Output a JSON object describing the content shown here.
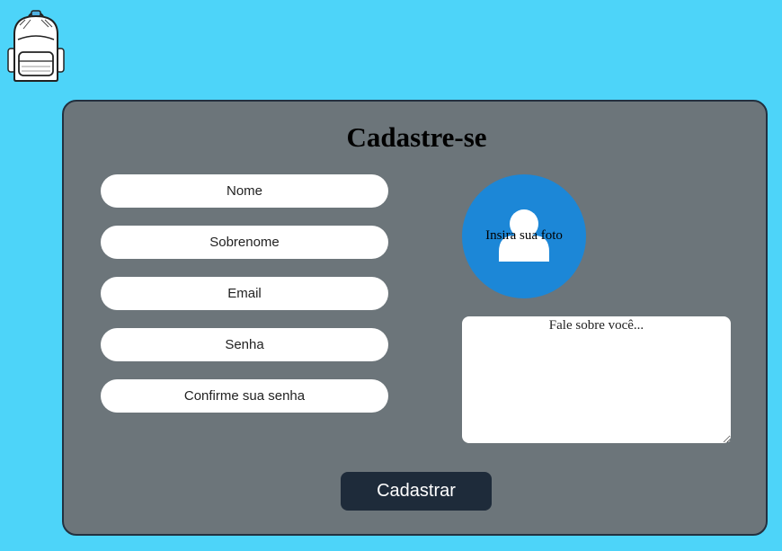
{
  "form": {
    "title": "Cadastre-se",
    "fields": {
      "nome": "Nome",
      "sobrenome": "Sobrenome",
      "email": "Email",
      "senha": "Senha",
      "confirmar_senha": "Confirme sua senha"
    },
    "photo_label": "Insira sua foto",
    "about_placeholder": "Fale sobre você...",
    "submit_label": "Cadastrar"
  },
  "icons": {
    "logo": "backpack-icon",
    "photo": "user-avatar-icon"
  },
  "colors": {
    "page_background": "#4dd4f9",
    "card_background": "#6c757a",
    "card_border": "#22303f",
    "photo_circle": "#1c87d7",
    "button_background": "#1e2b3a"
  }
}
